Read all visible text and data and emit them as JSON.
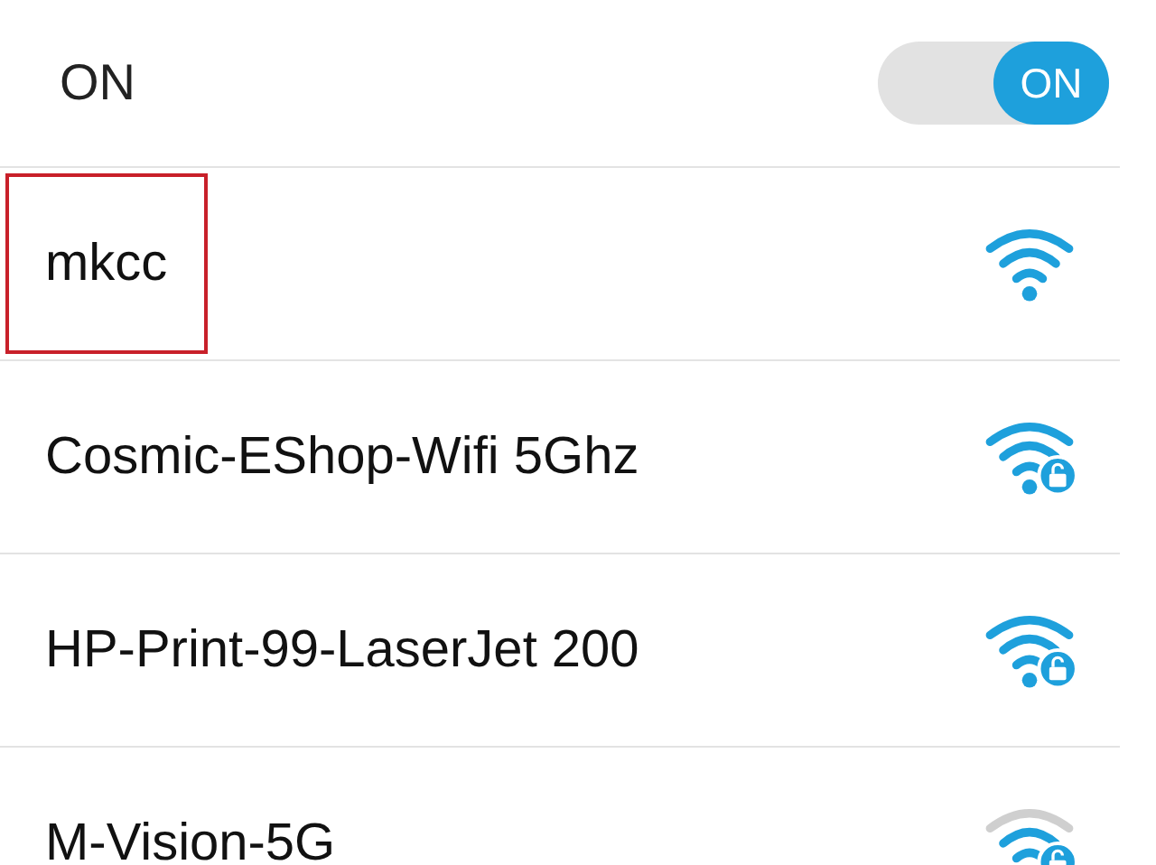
{
  "wifi_switch": {
    "label": "ON",
    "toggle_text": "ON",
    "on": true
  },
  "networks": [
    {
      "name": "mkcc",
      "secured": false,
      "weak_signal": false,
      "highlighted": true
    },
    {
      "name": "Cosmic-EShop-Wifi 5Ghz",
      "secured": true,
      "weak_signal": false,
      "highlighted": false
    },
    {
      "name": "HP-Print-99-LaserJet 200",
      "secured": true,
      "weak_signal": false,
      "highlighted": false
    },
    {
      "name": "M-Vision-5G",
      "secured": true,
      "weak_signal": true,
      "highlighted": false
    }
  ]
}
